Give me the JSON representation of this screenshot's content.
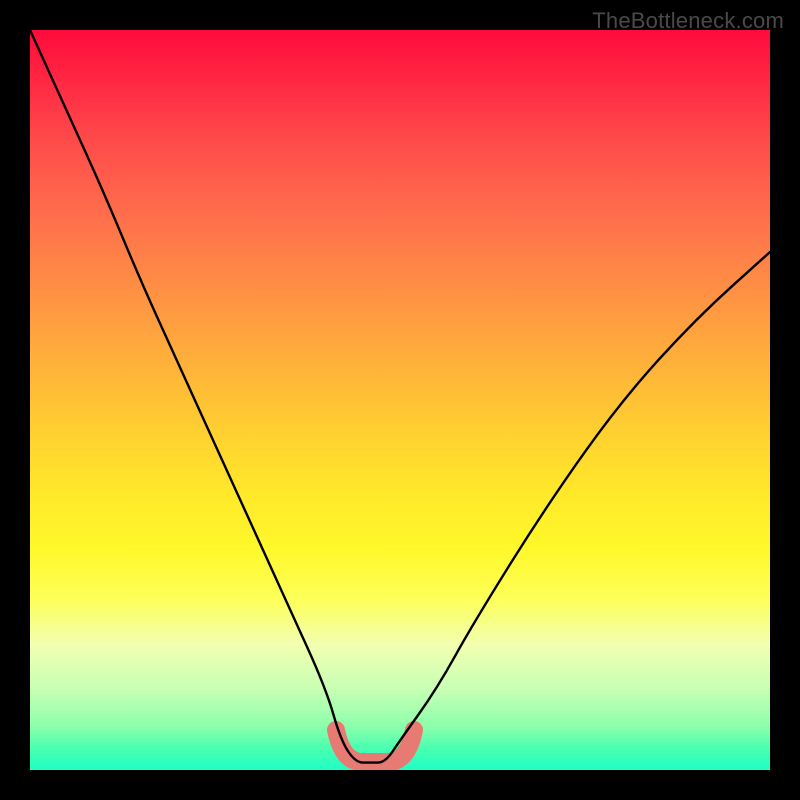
{
  "watermark": "TheBottleneck.com",
  "chart_data": {
    "type": "line",
    "title": "",
    "xlabel": "",
    "ylabel": "",
    "xlim": [
      0,
      100
    ],
    "ylim": [
      0,
      100
    ],
    "grid": false,
    "legend": false,
    "series": [
      {
        "name": "bottleneck-curve",
        "x": [
          0,
          5,
          10,
          15,
          20,
          25,
          30,
          35,
          40,
          42,
          44,
          46,
          48,
          50,
          55,
          60,
          70,
          80,
          90,
          100
        ],
        "values": [
          100,
          89,
          78,
          66,
          55,
          44,
          33,
          22,
          11,
          4,
          1,
          1,
          1,
          4,
          11,
          20,
          36,
          50,
          61,
          70
        ]
      }
    ],
    "annotations": [
      {
        "type": "flat-minimum-highlight",
        "x_start": 41,
        "x_end": 49,
        "color": "#e87a74"
      }
    ],
    "background": {
      "gradient": [
        "#ff0b3a",
        "#ffd22f",
        "#1effc5"
      ],
      "direction": "top-to-bottom"
    }
  },
  "colors": {
    "curve": "#000000",
    "highlight": "#e87a74",
    "frame": "#000000",
    "watermark": "#4a4a4a"
  }
}
